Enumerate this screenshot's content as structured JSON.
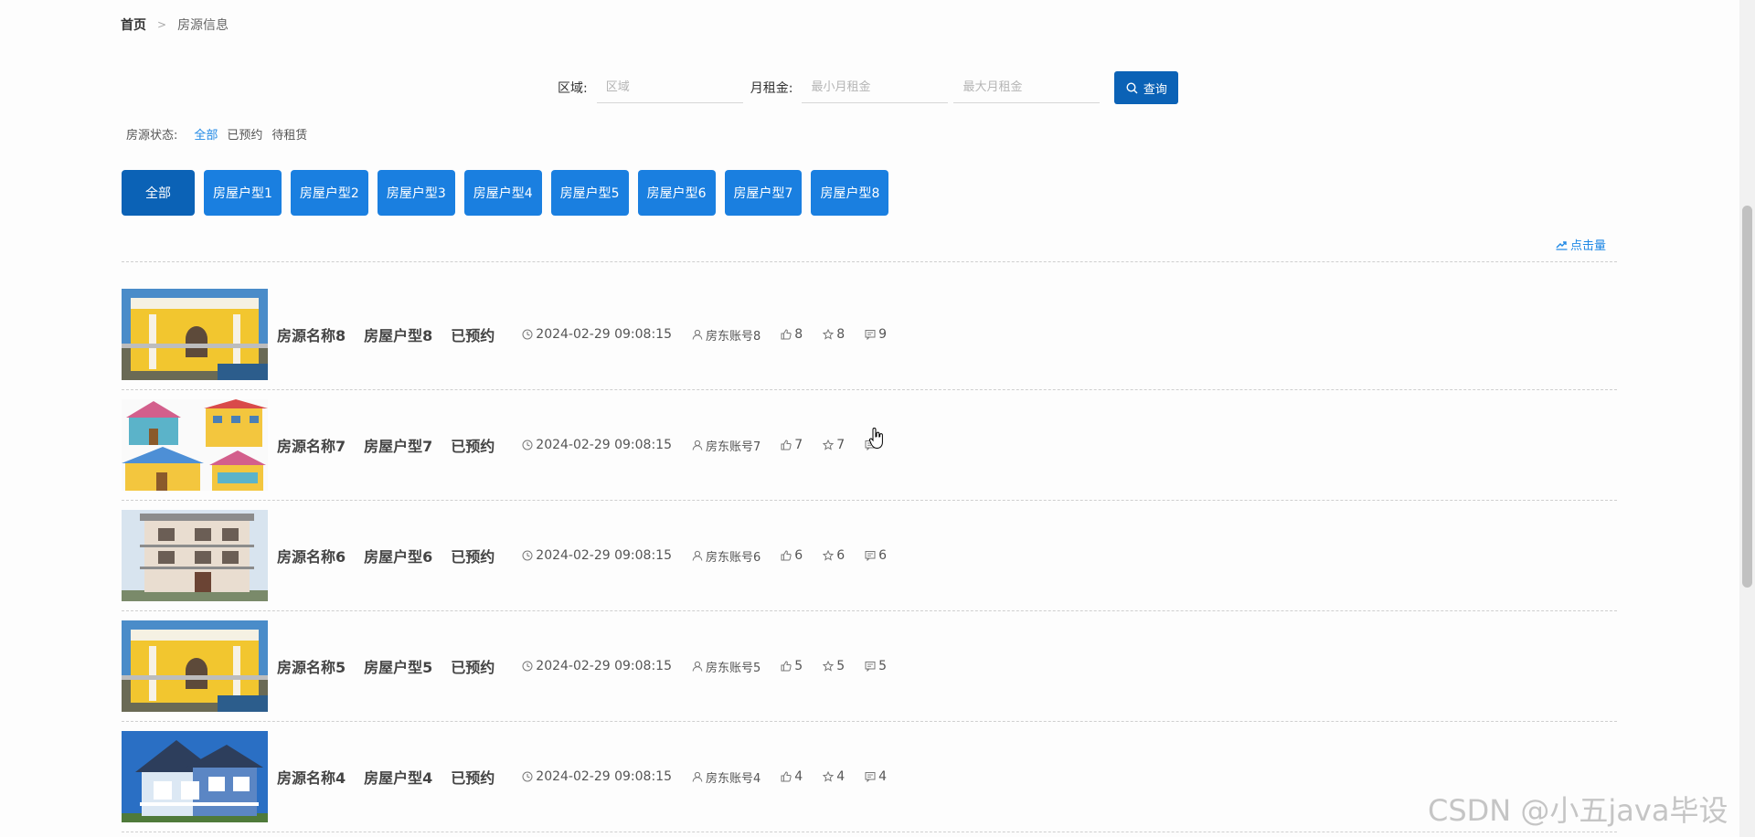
{
  "breadcrumb": {
    "home": "首页",
    "separator": ">",
    "current": "房源信息"
  },
  "search": {
    "area_label": "区域:",
    "area_placeholder": "区域",
    "rent_label": "月租金:",
    "rent_min_placeholder": "最小月租金",
    "rent_max_placeholder": "最大月租金",
    "query_button": "查询"
  },
  "status_filter": {
    "label": "房源状态:",
    "options": [
      "全部",
      "已预约",
      "待租赁"
    ],
    "active": "全部"
  },
  "type_filter": {
    "buttons": [
      "全部",
      "房屋户型1",
      "房屋户型2",
      "房屋户型3",
      "房屋户型4",
      "房屋户型5",
      "房屋户型6",
      "房屋户型7",
      "房屋户型8"
    ],
    "active": "全部"
  },
  "sort": {
    "label": "点击量"
  },
  "listings": [
    {
      "name": "房源名称8",
      "type": "房屋户型8",
      "status": "已预约",
      "time": "2024-02-29 09:08:15",
      "owner": "房东账号8",
      "likes": "8",
      "favorites": "8",
      "comments": "9",
      "image": "yellow-villa"
    },
    {
      "name": "房源名称7",
      "type": "房屋户型7",
      "status": "已预约",
      "time": "2024-02-29 09:08:15",
      "owner": "房东账号7",
      "likes": "7",
      "favorites": "7",
      "comments": "",
      "image": "cartoon-houses"
    },
    {
      "name": "房源名称6",
      "type": "房屋户型6",
      "status": "已预约",
      "time": "2024-02-29 09:08:15",
      "owner": "房东账号6",
      "likes": "6",
      "favorites": "6",
      "comments": "6",
      "image": "grey-townhouse"
    },
    {
      "name": "房源名称5",
      "type": "房屋户型5",
      "status": "已预约",
      "time": "2024-02-29 09:08:15",
      "owner": "房东账号5",
      "likes": "5",
      "favorites": "5",
      "comments": "5",
      "image": "yellow-villa"
    },
    {
      "name": "房源名称4",
      "type": "房屋户型4",
      "status": "已预约",
      "time": "2024-02-29 09:08:15",
      "owner": "房东账号4",
      "likes": "4",
      "favorites": "4",
      "comments": "4",
      "image": "blue-house"
    }
  ],
  "watermark": "CSDN @小五java毕设",
  "colors": {
    "primary": "#1a7fe0",
    "primary_dark": "#0b62b6",
    "link": "#1e88e5"
  }
}
